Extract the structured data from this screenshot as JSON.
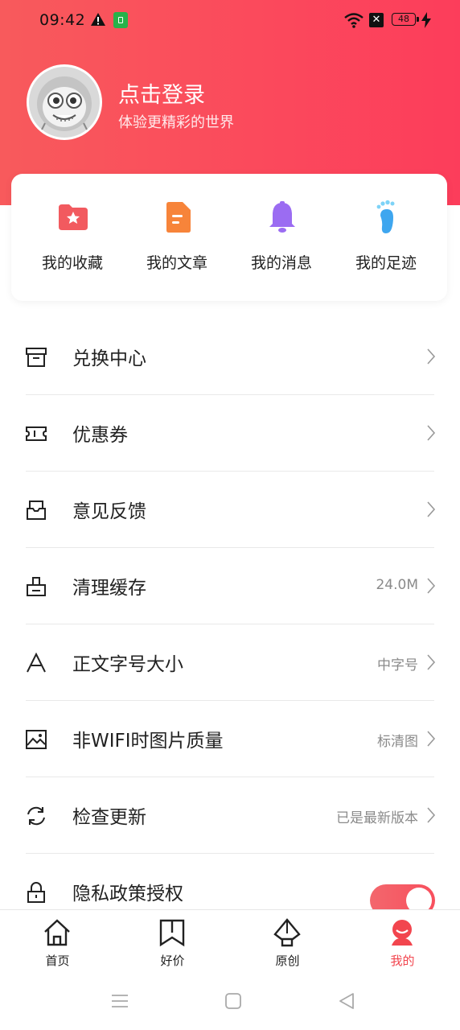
{
  "status_bar": {
    "time": "09:42",
    "battery": "48",
    "icons": [
      "warning-icon",
      "app-notification-icon",
      "wifi-icon",
      "sim-x-icon",
      "battery-icon",
      "charging-icon"
    ]
  },
  "profile": {
    "title": "点击登录",
    "subtitle": "体验更精彩的世界",
    "avatar_icon": "cartoon-avatar"
  },
  "quick_actions": [
    {
      "label": "我的收藏",
      "icon": "star-folder-icon",
      "color": "#f2535a"
    },
    {
      "label": "我的文章",
      "icon": "document-icon",
      "color": "#f7843a"
    },
    {
      "label": "我的消息",
      "icon": "bell-icon",
      "color": "#9b6cf2"
    },
    {
      "label": "我的足迹",
      "icon": "footprint-icon",
      "color": "#49b6f4"
    }
  ],
  "menu": [
    {
      "label": "兑换中心",
      "value": "",
      "icon": "archive-box-icon"
    },
    {
      "label": "优惠券",
      "value": "",
      "icon": "ticket-icon"
    },
    {
      "label": "意见反馈",
      "value": "",
      "icon": "inbox-icon"
    },
    {
      "label": "清理缓存",
      "value": "24.0M",
      "icon": "eraser-icon"
    },
    {
      "label": "正文字号大小",
      "value": "中字号",
      "icon": "font-size-icon"
    },
    {
      "label": "非WIFI时图片质量",
      "value": "标清图",
      "icon": "image-icon"
    },
    {
      "label": "检查更新",
      "value": "已是最新版本",
      "icon": "refresh-icon"
    },
    {
      "label": "隐私政策授权",
      "value": "",
      "icon": "lock-icon",
      "toggle_on": true
    }
  ],
  "bottom_nav": [
    {
      "label": "首页",
      "icon": "home-icon",
      "active": false
    },
    {
      "label": "好价",
      "icon": "bookmark-icon",
      "active": false
    },
    {
      "label": "原创",
      "icon": "pen-nib-icon",
      "active": false
    },
    {
      "label": "我的",
      "icon": "profile-icon",
      "active": true
    }
  ],
  "colors": {
    "brand": "#fb4a5c",
    "active_nav": "#f2454e"
  }
}
